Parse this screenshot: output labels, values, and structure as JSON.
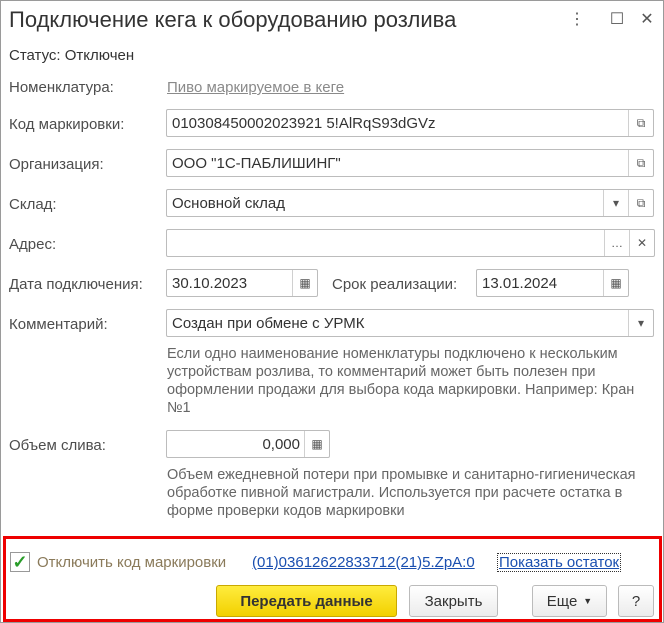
{
  "window": {
    "title": "Подключение кега к оборудованию розлива"
  },
  "status": "Статус: Отключен",
  "fields": {
    "nomenclature": {
      "label": "Номенклатура:",
      "value": "Пиво маркируемое в кеге"
    },
    "code": {
      "label": "Код маркировки:",
      "value": "010308450002023921 5!AlRqS93dGVz"
    },
    "org": {
      "label": "Организация:",
      "value": "ООО \"1С-ПАБЛИШИНГ\""
    },
    "warehouse": {
      "label": "Склад:",
      "value": "Основной склад"
    },
    "address": {
      "label": "Адрес:",
      "value": ""
    },
    "date": {
      "label": "Дата подключения:",
      "value": "30.10.2023"
    },
    "expiry": {
      "label": "Срок реализации:",
      "value": "13.01.2024"
    },
    "comment": {
      "label": "Комментарий:",
      "value": "Создан при обмене с УРМК",
      "hint": "Если одно наименование номенклатуры подключено к нескольким устройствам розлива, то комментарий может быть полезен при оформлении продажи для выбора кода маркировки. Например: Кран №1"
    },
    "volume": {
      "label": "Объем слива:",
      "value": "0,000",
      "hint": "Объем ежедневной потери при промывке и санитарно-гигиеническая обработке пивной магистрали. Используется при расчете остатка в форме проверки кодов маркировки"
    }
  },
  "footer": {
    "checkbox_label": "Отключить код маркировки",
    "checked": true,
    "code_link": "(01)03612622833712(21)5.ZpA:0",
    "show_rest": "Показать остаток",
    "send": "Передать данные",
    "close": "Закрыть",
    "more": "Еще",
    "help": "?"
  }
}
